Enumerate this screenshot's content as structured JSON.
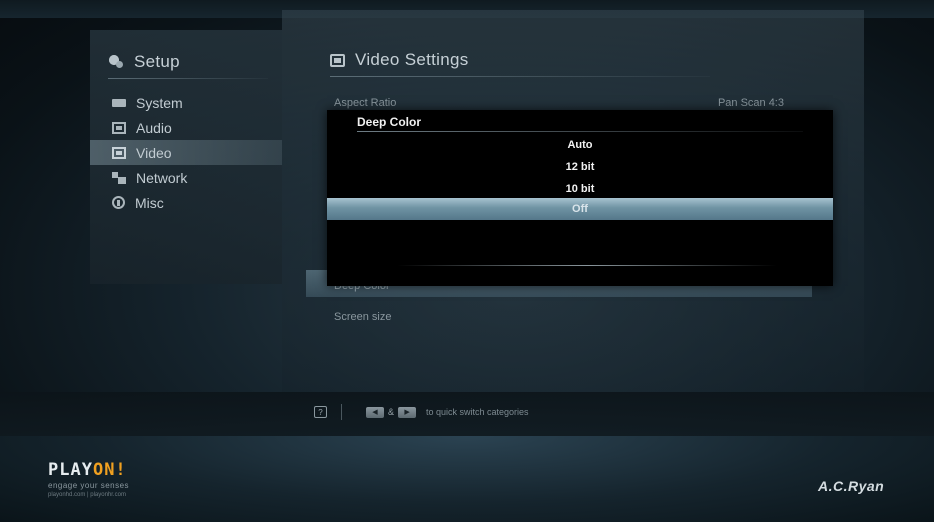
{
  "sidebar": {
    "title": "Setup",
    "items": [
      {
        "label": "System"
      },
      {
        "label": "Audio"
      },
      {
        "label": "Video"
      },
      {
        "label": "Network"
      },
      {
        "label": "Misc"
      }
    ]
  },
  "main": {
    "title": "Video Settings",
    "rows": [
      {
        "label": "Aspect Ratio",
        "value": "Pan Scan 4:3"
      },
      {
        "label": "Deep Color",
        "value": ""
      },
      {
        "label": "Screen size",
        "value": ""
      }
    ]
  },
  "popup": {
    "title": "Deep Color",
    "options": [
      "Auto",
      "12 bit",
      "10 bit",
      "Off"
    ],
    "selected": "Off"
  },
  "footer": {
    "hint_key": "?",
    "hint_text": "to quick switch categories",
    "amp": "&",
    "logo_play": "PLAY",
    "logo_on": "ON!",
    "tagline": "engage your senses",
    "urls": "playonhd.com | playonhr.com",
    "brand": "A.C.Ryan"
  },
  "colors": {
    "accent_orange": "#f0a020",
    "selection_blue": "#6f93a3",
    "popup_bg": "#000000"
  }
}
